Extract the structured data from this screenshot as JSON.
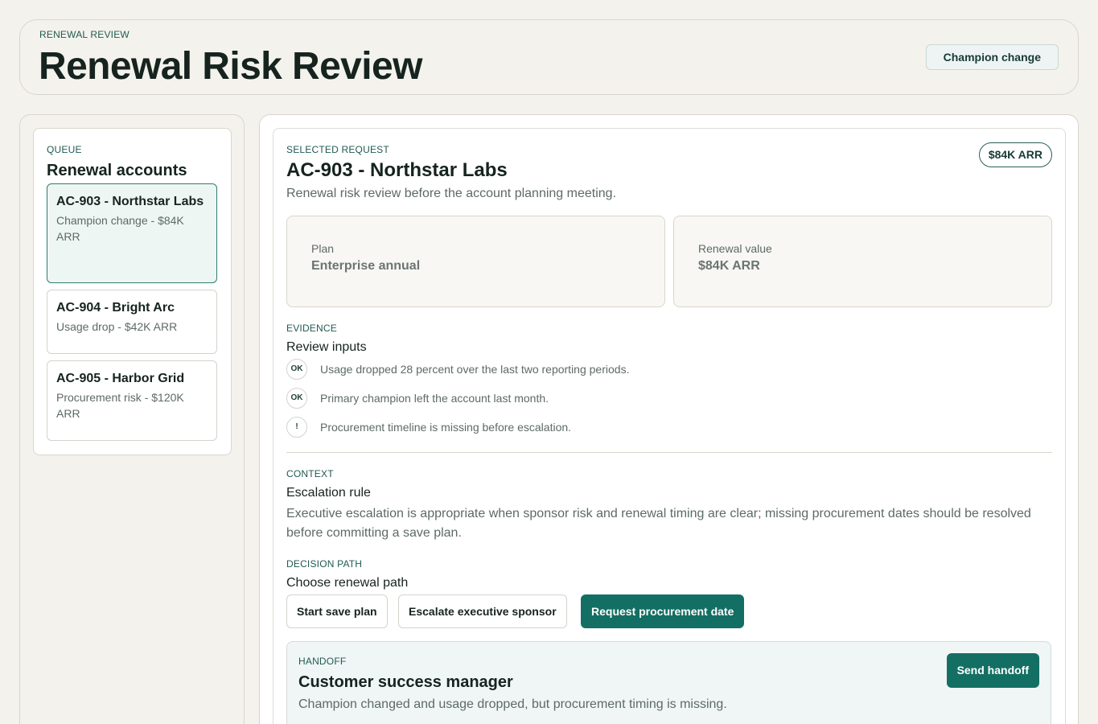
{
  "header": {
    "eyebrow": "RENEWAL REVIEW",
    "title": "Renewal Risk Review",
    "badge": "Champion change"
  },
  "queue": {
    "eyebrow": "QUEUE",
    "title": "Renewal accounts",
    "items": [
      {
        "name": "AC-903 - Northstar Labs",
        "meta": "Champion change - $84K ARR",
        "active": true
      },
      {
        "name": "AC-904 - Bright Arc",
        "meta": "Usage drop - $42K ARR",
        "active": false
      },
      {
        "name": "AC-905 - Harbor Grid",
        "meta": "Procurement risk - $120K ARR",
        "active": false
      }
    ]
  },
  "detail": {
    "eyebrow": "SELECTED REQUEST",
    "title": "AC-903 - Northstar Labs",
    "subtitle": "Renewal risk review before the account planning meeting.",
    "arr_badge": "$84K ARR",
    "stats": [
      {
        "label": "Plan",
        "value": "Enterprise annual"
      },
      {
        "label": "Renewal value",
        "value": "$84K ARR"
      }
    ],
    "evidence": {
      "eyebrow": "EVIDENCE",
      "title": "Review inputs",
      "items": [
        {
          "badge": "OK",
          "text": "Usage dropped 28 percent over the last two reporting periods."
        },
        {
          "badge": "OK",
          "text": "Primary champion left the account last month."
        },
        {
          "badge": "!",
          "text": "Procurement timeline is missing before escalation."
        }
      ]
    },
    "context": {
      "eyebrow": "CONTEXT",
      "title": "Escalation rule",
      "text": "Executive escalation is appropriate when sponsor risk and renewal timing are clear; missing procurement dates should be resolved before committing a save plan."
    },
    "decision": {
      "eyebrow": "DECISION PATH",
      "title": "Choose renewal path",
      "options": [
        "Start save plan",
        "Escalate executive sponsor",
        "Request procurement date"
      ],
      "selected": "Request procurement date"
    },
    "handoff": {
      "eyebrow": "HANDOFF",
      "title": "Customer success manager",
      "text": "Champion changed and usage dropped, but procurement timing is missing.",
      "button": "Send handoff"
    }
  }
}
